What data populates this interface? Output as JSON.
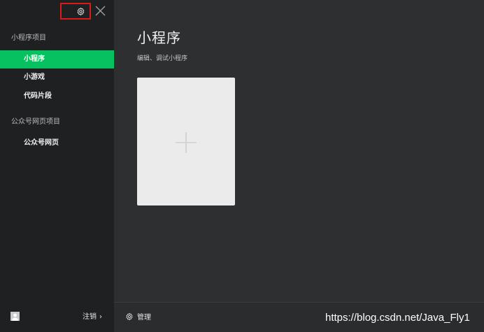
{
  "sidebar": {
    "sections": [
      {
        "label": "小程序项目",
        "items": [
          {
            "label": "小程序",
            "active": true
          },
          {
            "label": "小游戏",
            "active": false
          },
          {
            "label": "代码片段",
            "active": false
          }
        ]
      },
      {
        "label": "公众号网页项目",
        "items": [
          {
            "label": "公众号网页",
            "active": false
          }
        ]
      }
    ],
    "footer": {
      "logout_label": "注销",
      "logout_chevron": "›"
    },
    "icons": {
      "settings": "gear-icon",
      "close": "close-icon",
      "avatar": "avatar-icon"
    }
  },
  "main": {
    "title": "小程序",
    "subtitle": "编辑、调试小程序",
    "create_card_icon": "plus-icon",
    "footer": {
      "manage_label": "管理",
      "manage_icon": "gear-icon"
    }
  },
  "watermark": "https://blog.csdn.net/Java_Fly1",
  "colors": {
    "sidebar_bg": "#1f2022",
    "main_bg": "#2e2f31",
    "accent": "#07c160",
    "highlight_box": "#d9191c",
    "card_bg": "#ebebeb"
  }
}
